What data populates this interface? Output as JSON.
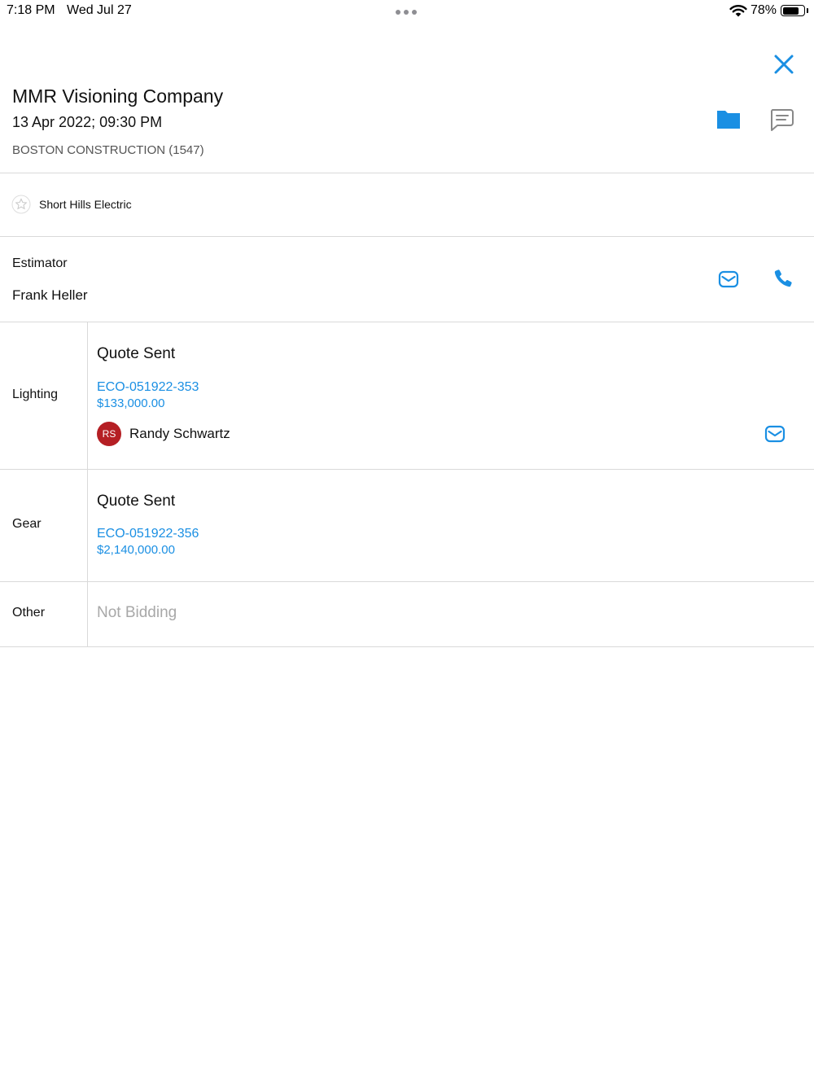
{
  "status_bar": {
    "time": "7:18 PM",
    "date": "Wed Jul 27",
    "battery": "78%",
    "battery_level": 0.78
  },
  "header": {
    "company_name": "MMR Visioning Company",
    "date_time": "13 Apr 2022; 09:30 PM",
    "project_name": "BOSTON CONSTRUCTION (1547)"
  },
  "contractor": {
    "name": "Short Hills Electric"
  },
  "estimator": {
    "label": "Estimator",
    "name": "Frank Heller"
  },
  "bids": {
    "lighting": {
      "category": "Lighting",
      "status": "Quote Sent",
      "quote_id": "ECO-051922-353",
      "amount": "$133,000.00",
      "rep_initials": "RS",
      "rep_name": "Randy Schwartz"
    },
    "gear": {
      "category": "Gear",
      "status": "Quote Sent",
      "quote_id": "ECO-051922-356",
      "amount": "$2,140,000.00"
    },
    "other": {
      "category": "Other",
      "status": "Not Bidding"
    }
  },
  "colors": {
    "accent": "#1a8fe3",
    "avatar": "#b51f24",
    "divider": "#d9d9d9"
  },
  "icons": [
    "close-icon",
    "folder-icon",
    "chat-icon",
    "star-icon",
    "mail-icon",
    "phone-icon",
    "wifi-icon",
    "battery-icon"
  ]
}
